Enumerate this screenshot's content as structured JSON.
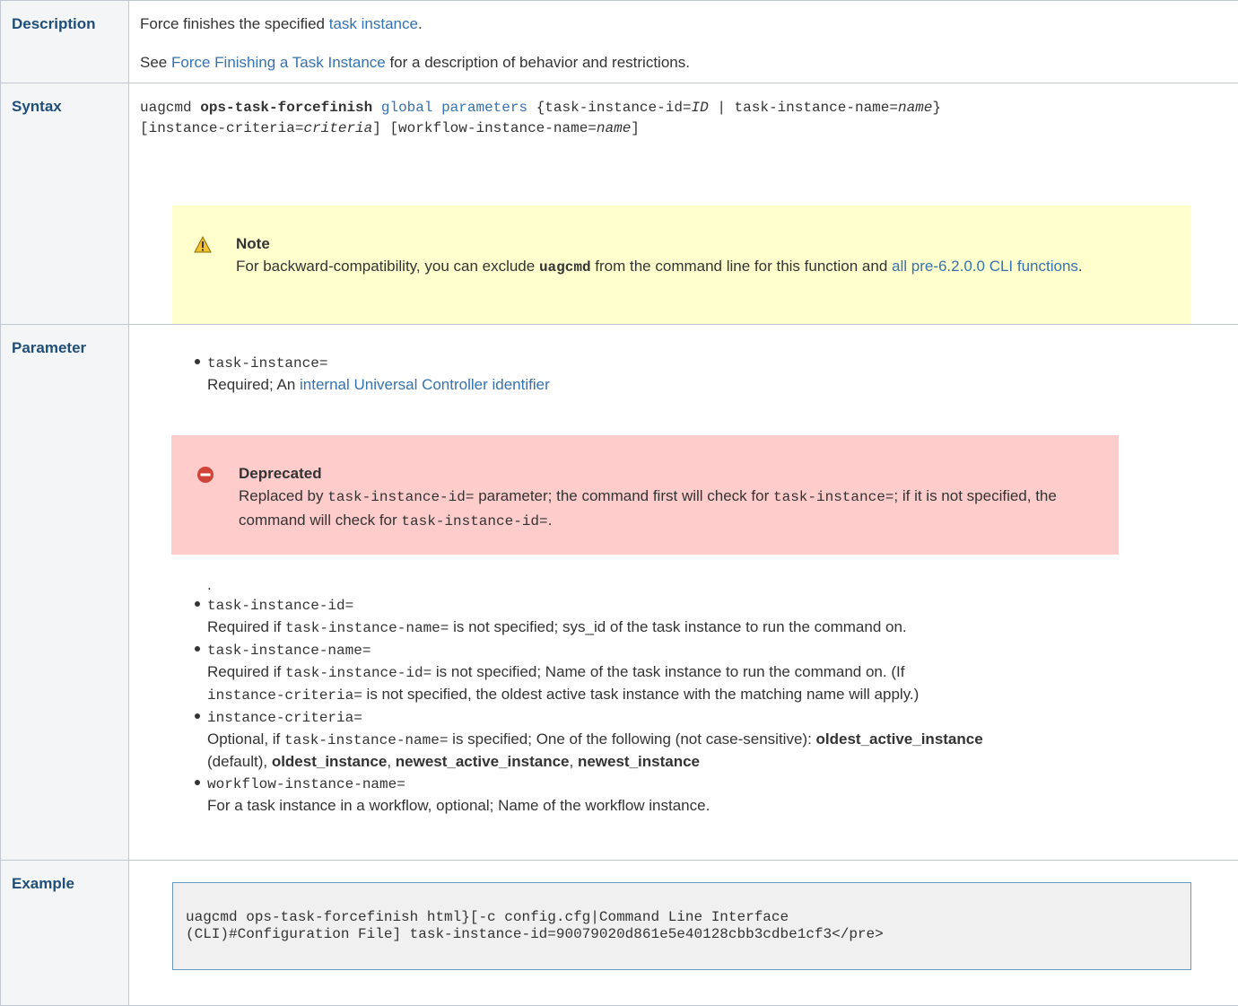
{
  "rows": {
    "description": {
      "header": "Description",
      "line1_pre": "Force finishes the specified ",
      "line1_link": "task instance",
      "line1_post": ".",
      "line2_pre": "See ",
      "line2_link": "Force Finishing a Task Instance",
      "line2_post": " for a description of behavior and restrictions."
    },
    "syntax": {
      "header": "Syntax",
      "cmd": "uagcmd ",
      "cmd_bold": "ops-task-forcefinish",
      "global_link": "global parameters",
      "p1": " {task-instance-id=",
      "p1_it": "ID",
      "p2": " | task-instance-name=",
      "p2_it": "name",
      "p3": "}",
      "line2_a": "[instance-criteria=",
      "line2_a_it": "criteria",
      "line2_b": "] [workflow-instance-name=",
      "line2_b_it": "name",
      "line2_c": "]",
      "note": {
        "title": "Note",
        "text_pre": "For backward-compatibility, you can exclude ",
        "text_code": "uagcmd",
        "text_mid": " from the command line for this function and ",
        "link": "all pre-6.2.0.0 CLI functions",
        "text_post": "."
      }
    },
    "parameter": {
      "header": "Parameter",
      "p1_name": "task-instance=",
      "p1_desc_pre": "Required; An ",
      "p1_desc_link": "internal Universal Controller identifier",
      "deprecated": {
        "title": "Deprecated",
        "t1": "Replaced by ",
        "c1": "task-instance-id=",
        "t2": " parameter; the command first will check for ",
        "c2": "task-instance=",
        "t3": "; if it is not specified, the command will check for ",
        "c3": "task-instance-id=",
        "t4": "."
      },
      "dot": ".",
      "p2_name": "task-instance-id=",
      "p2_t1": "Required if ",
      "p2_c1": "task-instance-name=",
      "p2_t2": " is not specified; sys_id of the task instance to run the command on.",
      "p3_name": "task-instance-name=",
      "p3_t1": "Required if ",
      "p3_c1": "task-instance-id=",
      "p3_t2": " is not specified; Name of the task instance to run the command on. (If",
      "p3_c2": "instance-criteria=",
      "p3_t3": " is not specified, the oldest active task instance with the matching name will apply.)",
      "p4_name": "instance-criteria=",
      "p4_t1": "Optional, if ",
      "p4_c1": "task-instance-name=",
      "p4_t2": " is specified; One of the following (not case-sensitive): ",
      "p4_b1": "oldest_active_instance",
      "p4_t3": "(default), ",
      "p4_b2": "oldest_instance",
      "p4_s1": ", ",
      "p4_b3": "newest_active_instance",
      "p4_s2": ", ",
      "p4_b4": "newest_instance",
      "p5_name": "workflow-instance-name=",
      "p5_desc": "For a task instance in a workflow, optional; Name of the workflow instance."
    },
    "example": {
      "header": "Example",
      "line1": "uagcmd ops-task-forcefinish html}[-c config.cfg|Command Line Interface",
      "line2": "(CLI)#Configuration File] task-instance-id=90079020d861e5e40128cbb3cdbe1cf3</pre>"
    }
  },
  "colors": {
    "header_text": "#1f4e79",
    "link": "#3572b0",
    "note_bg": "#ffffce",
    "deprecated_bg": "#ffcccc",
    "code_bg": "#f0f0f0",
    "code_border": "#6994c4"
  }
}
